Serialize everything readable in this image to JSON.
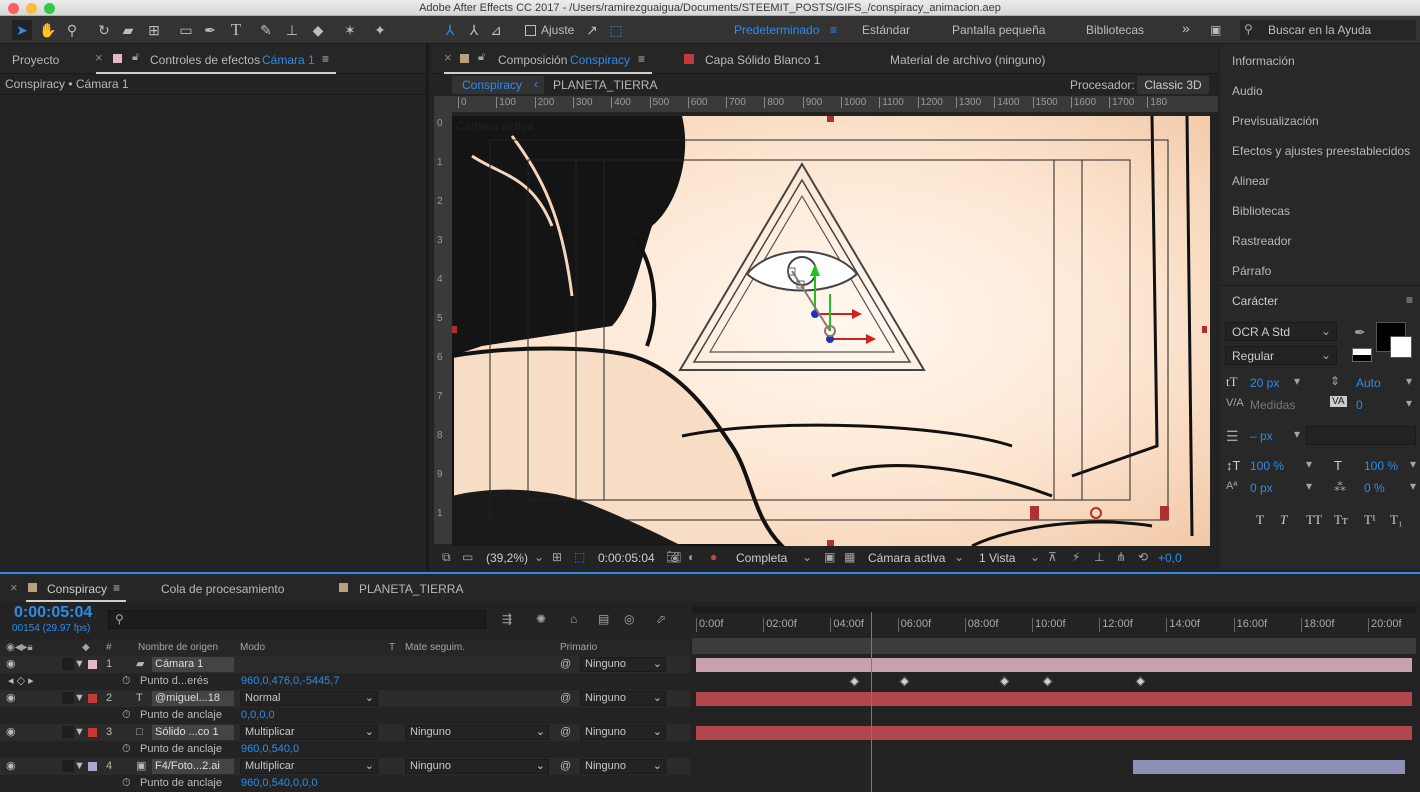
{
  "window": {
    "title": "Adobe After Effects CC 2017 - /Users/ramirezguaigua/Documents/STEEMIT_POSTS/GIFS_/conspiracy_animacion.aep"
  },
  "toolbar": {
    "snap_label": "Ajuste",
    "workspaces": [
      "Predeterminado",
      "Estándar",
      "Pantalla pequeña",
      "Bibliotecas"
    ],
    "more": "»",
    "search_placeholder": "Buscar en la Ayuda"
  },
  "left_panel": {
    "tab_project": "Proyecto",
    "tab_effects": "Controles de efectos",
    "effects_target": "Cámara 1",
    "breadcrumb": "Conspiracy • Cámara 1"
  },
  "comp_panel": {
    "tab_comp_prefix": "Composición",
    "tab_comp_name": "Conspiracy",
    "tab_layer": "Capa Sólido Blanco 1",
    "tab_footage": "Material de archivo (ninguno)",
    "subtab_active": "Conspiracy",
    "subtab_other": "PLANETA_TIERRA",
    "renderer_label": "Procesador:",
    "renderer_value": "Classic 3D",
    "view_label": "Cámara activa"
  },
  "ruler": {
    "h": [
      "0",
      "100",
      "200",
      "300",
      "400",
      "500",
      "600",
      "700",
      "800",
      "900",
      "1000",
      "1100",
      "1200",
      "1300",
      "1400",
      "1500",
      "1600",
      "1700",
      "180"
    ],
    "v": [
      "0",
      "1",
      "2",
      "3",
      "4",
      "5",
      "6",
      "7",
      "8",
      "9",
      "1"
    ]
  },
  "viewer_bar": {
    "zoom": "(39,2%)",
    "timecode": "0:00:05:04",
    "resolution": "Completa",
    "camera": "Cámara activa",
    "views": "1 Vista",
    "exposure": "+0,0"
  },
  "right_panel": {
    "items": [
      "Información",
      "Audio",
      "Previsualización",
      "Efectos y ajustes preestablecidos",
      "Alinear",
      "Bibliotecas",
      "Rastreador",
      "Párrafo"
    ],
    "character": {
      "title": "Carácter",
      "font": "OCR A Std",
      "style": "Regular",
      "size": "20 px",
      "leading": "Auto",
      "kerning": "Medidas",
      "tracking": "0",
      "stroke": "– px",
      "vscale": "100 %",
      "hscale": "100 %",
      "baseline": "0 px",
      "tsume": "0 %",
      "styles": [
        "T",
        "T",
        "TT",
        "Tт",
        "T¹",
        "T₁"
      ]
    }
  },
  "timeline": {
    "tab_comp": "Conspiracy",
    "tab_render": "Cola de procesamiento",
    "tab_planet": "PLANETA_TIERRA",
    "timecode": "0:00:05:04",
    "frames": "00154 (29.97 fps)",
    "search_placeholder": "",
    "columns": {
      "num": "#",
      "source": "Nombre de origen",
      "mode": "Modo",
      "t": "T",
      "matte": "Mate seguim.",
      "parent": "Primario"
    },
    "ticks": [
      "0:00f",
      "02:00f",
      "04:00f",
      "06:00f",
      "08:00f",
      "10:00f",
      "12:00f",
      "14:00f",
      "16:00f",
      "18:00f",
      "20:00f"
    ],
    "layers": [
      {
        "num": "1",
        "name": "Cámara 1",
        "mode": "",
        "matte": "",
        "parent": "Ninguno",
        "color": "#e6b7c6",
        "prop_name": "Punto d...erés",
        "prop_value": "960,0,476,0,-5445,7",
        "bar_color": "#c8a0b0",
        "bar_start": 0,
        "bar_end": 1
      },
      {
        "num": "2",
        "name": "@miguel...18",
        "mode": "Normal",
        "matte": "",
        "parent": "Ninguno",
        "color": "#c23a3a",
        "prop_name": "Punto de anclaje",
        "prop_value": "0,0,0,0",
        "bar_color": "#b3464d",
        "bar_start": 0,
        "bar_end": 1
      },
      {
        "num": "3",
        "name": "Sólido ...co 1",
        "mode": "Multiplicar",
        "matte": "Ninguno",
        "parent": "Ninguno",
        "color": "#c23a3a",
        "prop_name": "Punto de anclaje",
        "prop_value": "960,0,540,0",
        "bar_color": "#b3464d",
        "bar_start": 0,
        "bar_end": 1
      },
      {
        "num": "4",
        "name": "F4/Foto...2.ai",
        "mode": "Multiplicar",
        "matte": "Ninguno",
        "parent": "Ninguno",
        "color": "#a8a8cc",
        "prop_name": "Punto de anclaje",
        "prop_value": "960,0,540,0,0,0",
        "bar_color": "#8f8fb8",
        "bar_start": 0.61,
        "bar_end": 0.99
      }
    ],
    "keyframes": [
      0.22,
      0.29,
      0.43,
      0.49,
      0.62
    ],
    "playhead": 0.245
  },
  "colors": {
    "accent": "#2d8ceb",
    "bg": "#232323",
    "panel": "#282828"
  }
}
